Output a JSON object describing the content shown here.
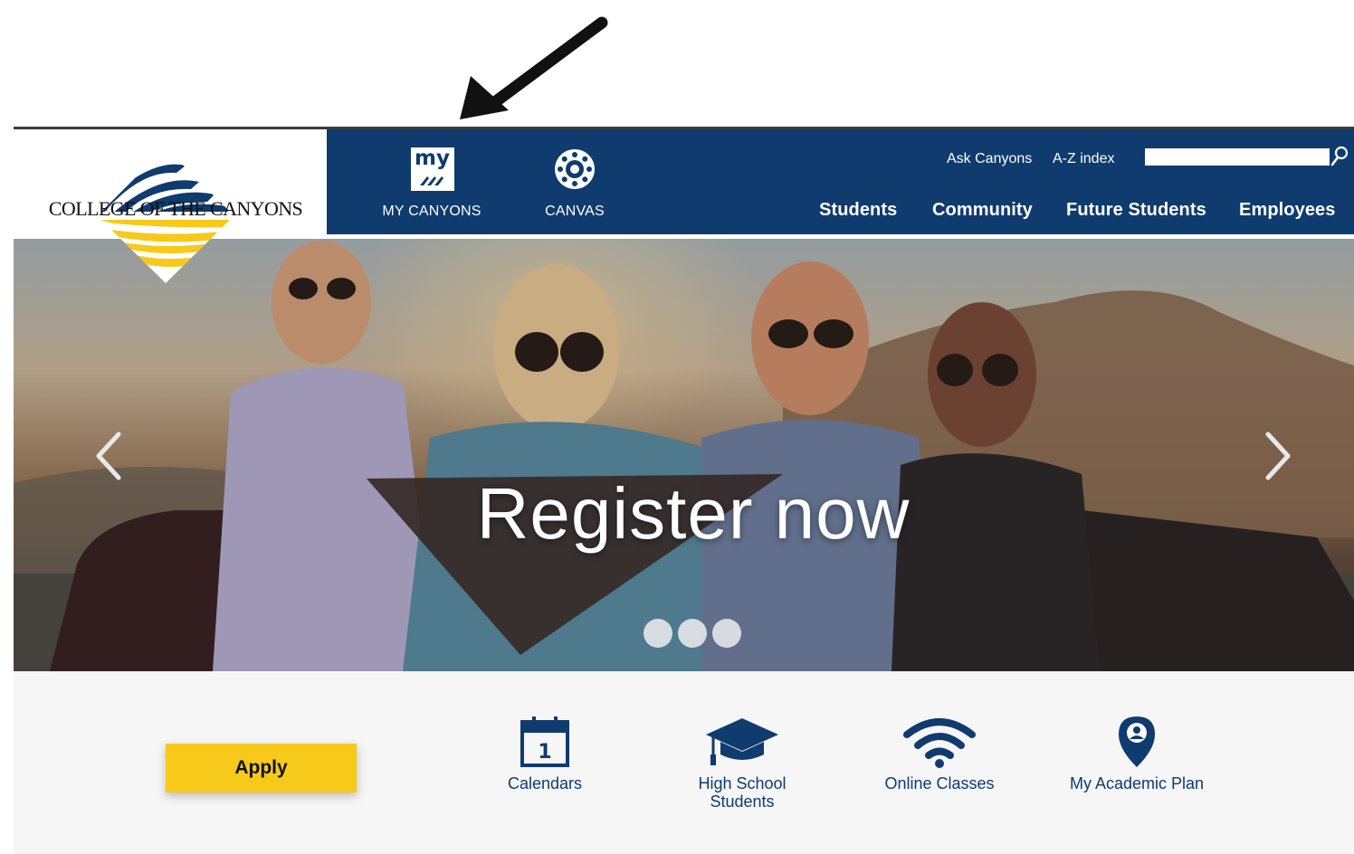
{
  "logo": {
    "text": "COLLEGE OF THE CANYONS"
  },
  "quick_links": [
    {
      "label": "MY CANYONS",
      "icon": "my-canyons-icon",
      "icon_text": "my"
    },
    {
      "label": "CANVAS",
      "icon": "canvas-icon"
    }
  ],
  "utility": {
    "ask": "Ask Canyons",
    "az": "A-Z index",
    "search_value": ""
  },
  "nav": [
    "Students",
    "Community",
    "Future Students",
    "Employees"
  ],
  "hero": {
    "title": "Register now",
    "slide_count": 3,
    "active_slide": 1
  },
  "apply_label": "Apply",
  "features": [
    {
      "label": "Calendars",
      "icon": "calendar-icon",
      "icon_text": "1"
    },
    {
      "label": "High School Students",
      "icon": "graduation-cap-icon"
    },
    {
      "label": "Online Classes",
      "icon": "wifi-icon"
    },
    {
      "label": "My Academic Plan",
      "icon": "location-pin-icon"
    }
  ],
  "colors": {
    "navy": "#0f3b6e",
    "gold": "#f7c91a",
    "white": "#ffffff"
  }
}
